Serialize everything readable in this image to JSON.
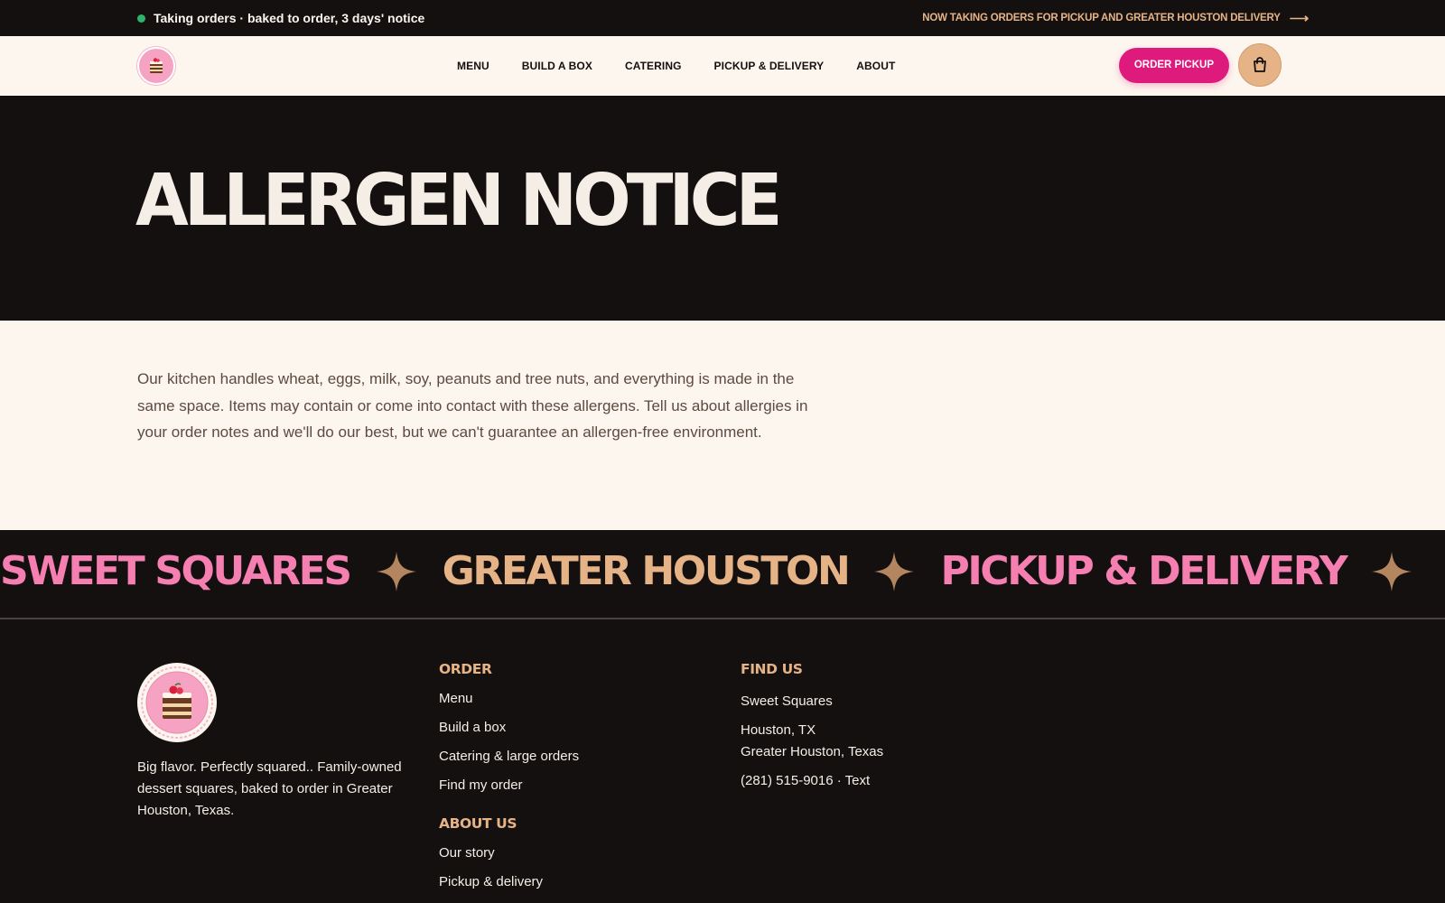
{
  "announcement": {
    "status_text": "Taking orders · baked to order, 3 days' notice",
    "promo_link": "NOW TAKING ORDERS FOR PICKUP AND GREATER HOUSTON DELIVERY",
    "arrow_icon": "arrow-right-icon"
  },
  "header": {
    "logo_icon": "sweet-squares-logo",
    "nav": [
      {
        "label": "MENU"
      },
      {
        "label": "BUILD A BOX"
      },
      {
        "label": "CATERING"
      },
      {
        "label": "PICKUP & DELIVERY"
      },
      {
        "label": "ABOUT"
      }
    ],
    "order_button": "ORDER PICKUP",
    "cart_icon": "shopping-bag-icon"
  },
  "hero": {
    "title": "ALLERGEN NOTICE"
  },
  "notice": {
    "body": "Our kitchen handles wheat, eggs, milk, soy, peanuts and tree nuts, and everything is made in the same space. Items may contain or come into contact with these allergens. Tell us about allergies in your order notes and we'll do our best, but we can't guarantee an allergen-free environment."
  },
  "marquee": {
    "items": [
      "SWEET SQUARES",
      "GREATER HOUSTON",
      "PICKUP & DELIVERY"
    ],
    "separator_icon": "sparkle-star-icon"
  },
  "footer": {
    "logo_icon": "sweet-squares-badge-logo",
    "tagline": "Big flavor. Perfectly squared.. Family-owned dessert squares, baked to order in Greater Houston, Texas.",
    "order_heading": "ORDER",
    "order_links": [
      "Menu",
      "Build a box",
      "Catering & large orders",
      "Find my order"
    ],
    "about_heading": "ABOUT US",
    "about_links": [
      "Our story",
      "Pickup & delivery"
    ],
    "find_heading": "FIND US",
    "business_name": "Sweet Squares",
    "city": "Houston, TX",
    "region": "Greater Houston, Texas",
    "phone": "(281) 515-9016 · Text"
  },
  "colors": {
    "dark": "#141010",
    "cream": "#fdf6ef",
    "pink_accent": "#de1a7c",
    "pink_light": "#f47fb0",
    "tan": "#e5b386",
    "status_green": "#2fb36a"
  }
}
